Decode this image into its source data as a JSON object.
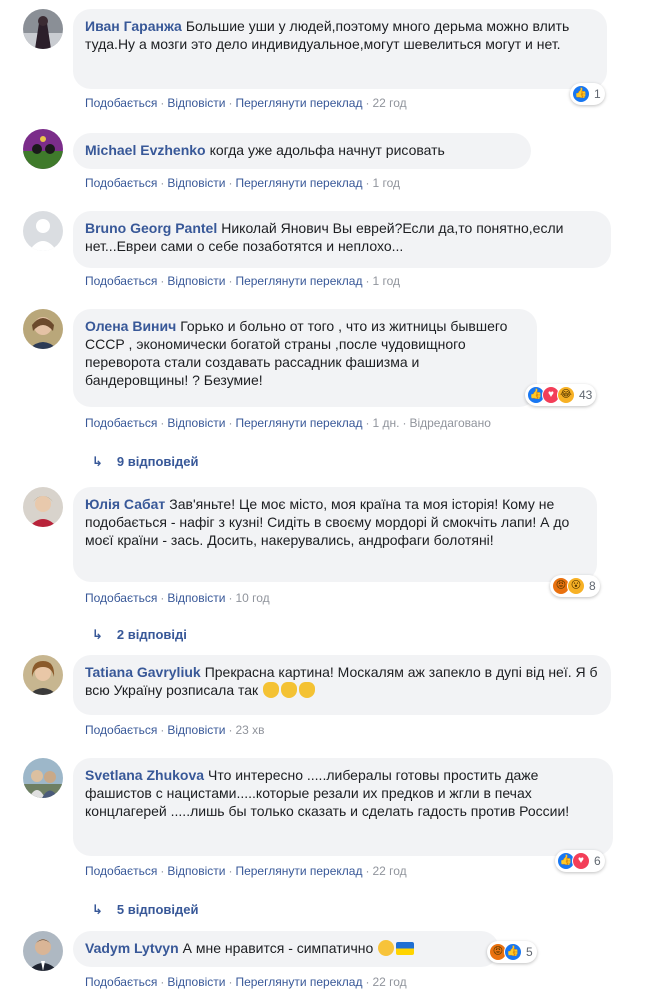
{
  "labels": {
    "like": "Подобається",
    "reply": "Відповісти",
    "translate": "Переглянути переклад",
    "dot": "·",
    "edited": "Відредаговано"
  },
  "colors": {
    "author": "#385898",
    "bubble": "#f2f3f5",
    "like": "#1877f2",
    "love": "#f33e58"
  },
  "comments": [
    {
      "author": "Иван Гаранжа",
      "text": "Большие уши у людей,поэтому много дерьма можно влить туда.Ну а мозги это дело индивидуальное,могут шевелиться могут и нет.",
      "time": "22 год",
      "reaction_count": "1"
    },
    {
      "author": "Michael Evzhenko",
      "text": "когда уже адольфа начнут рисовать",
      "time": "1 год"
    },
    {
      "author": "Bruno Georg Pantel",
      "text": "Николай Янович Вы еврей?Если да,то понятно,если нет...Евреи сами о себе позаботятся и неплохо...",
      "time": "1 год"
    },
    {
      "author": "Олена Винич",
      "text": "Горько и больно от того , что из житницы бывшего СССР , экономически богатой страны ,после чудовищного переворота стали создавать рассадник фашизма и бандеровщины! ? Безумие!",
      "time": "1 дн.",
      "reaction_count": "43",
      "replies": "9 відповідей"
    },
    {
      "author": "Юлія Сабат",
      "text": "Зав'яньте! Це моє місто, моя країна та моя історія! Кому не подобається - нафіг з кузні! Сидіть в своєму мордорі й смокчіть лапи! А до моєї країни - зась. Досить, накерувались, андрофаги болотяні!",
      "time": "10 год",
      "reaction_count": "8",
      "replies": "2 відповіді"
    },
    {
      "author": "Tatiana Gavryliuk",
      "text": "Прекрасна картина! Москалям аж запекло в дупі від неї. Я б всю Україну розписала так",
      "time": "23 хв"
    },
    {
      "author": "Svetlana Zhukova",
      "text": "Что интересно .....либералы готовы простить даже фашистов с нацистами.....которые резали их предков и жгли в печах концлагерей .....лишь бы только сказать и сделать гадость против России!",
      "time": "22 год",
      "reaction_count": "6",
      "replies": "5 відповідей"
    },
    {
      "author": "Vadym Lytvyn",
      "text": "А мне нравится - симпатично",
      "time": "22 год",
      "reaction_count": "5"
    }
  ]
}
